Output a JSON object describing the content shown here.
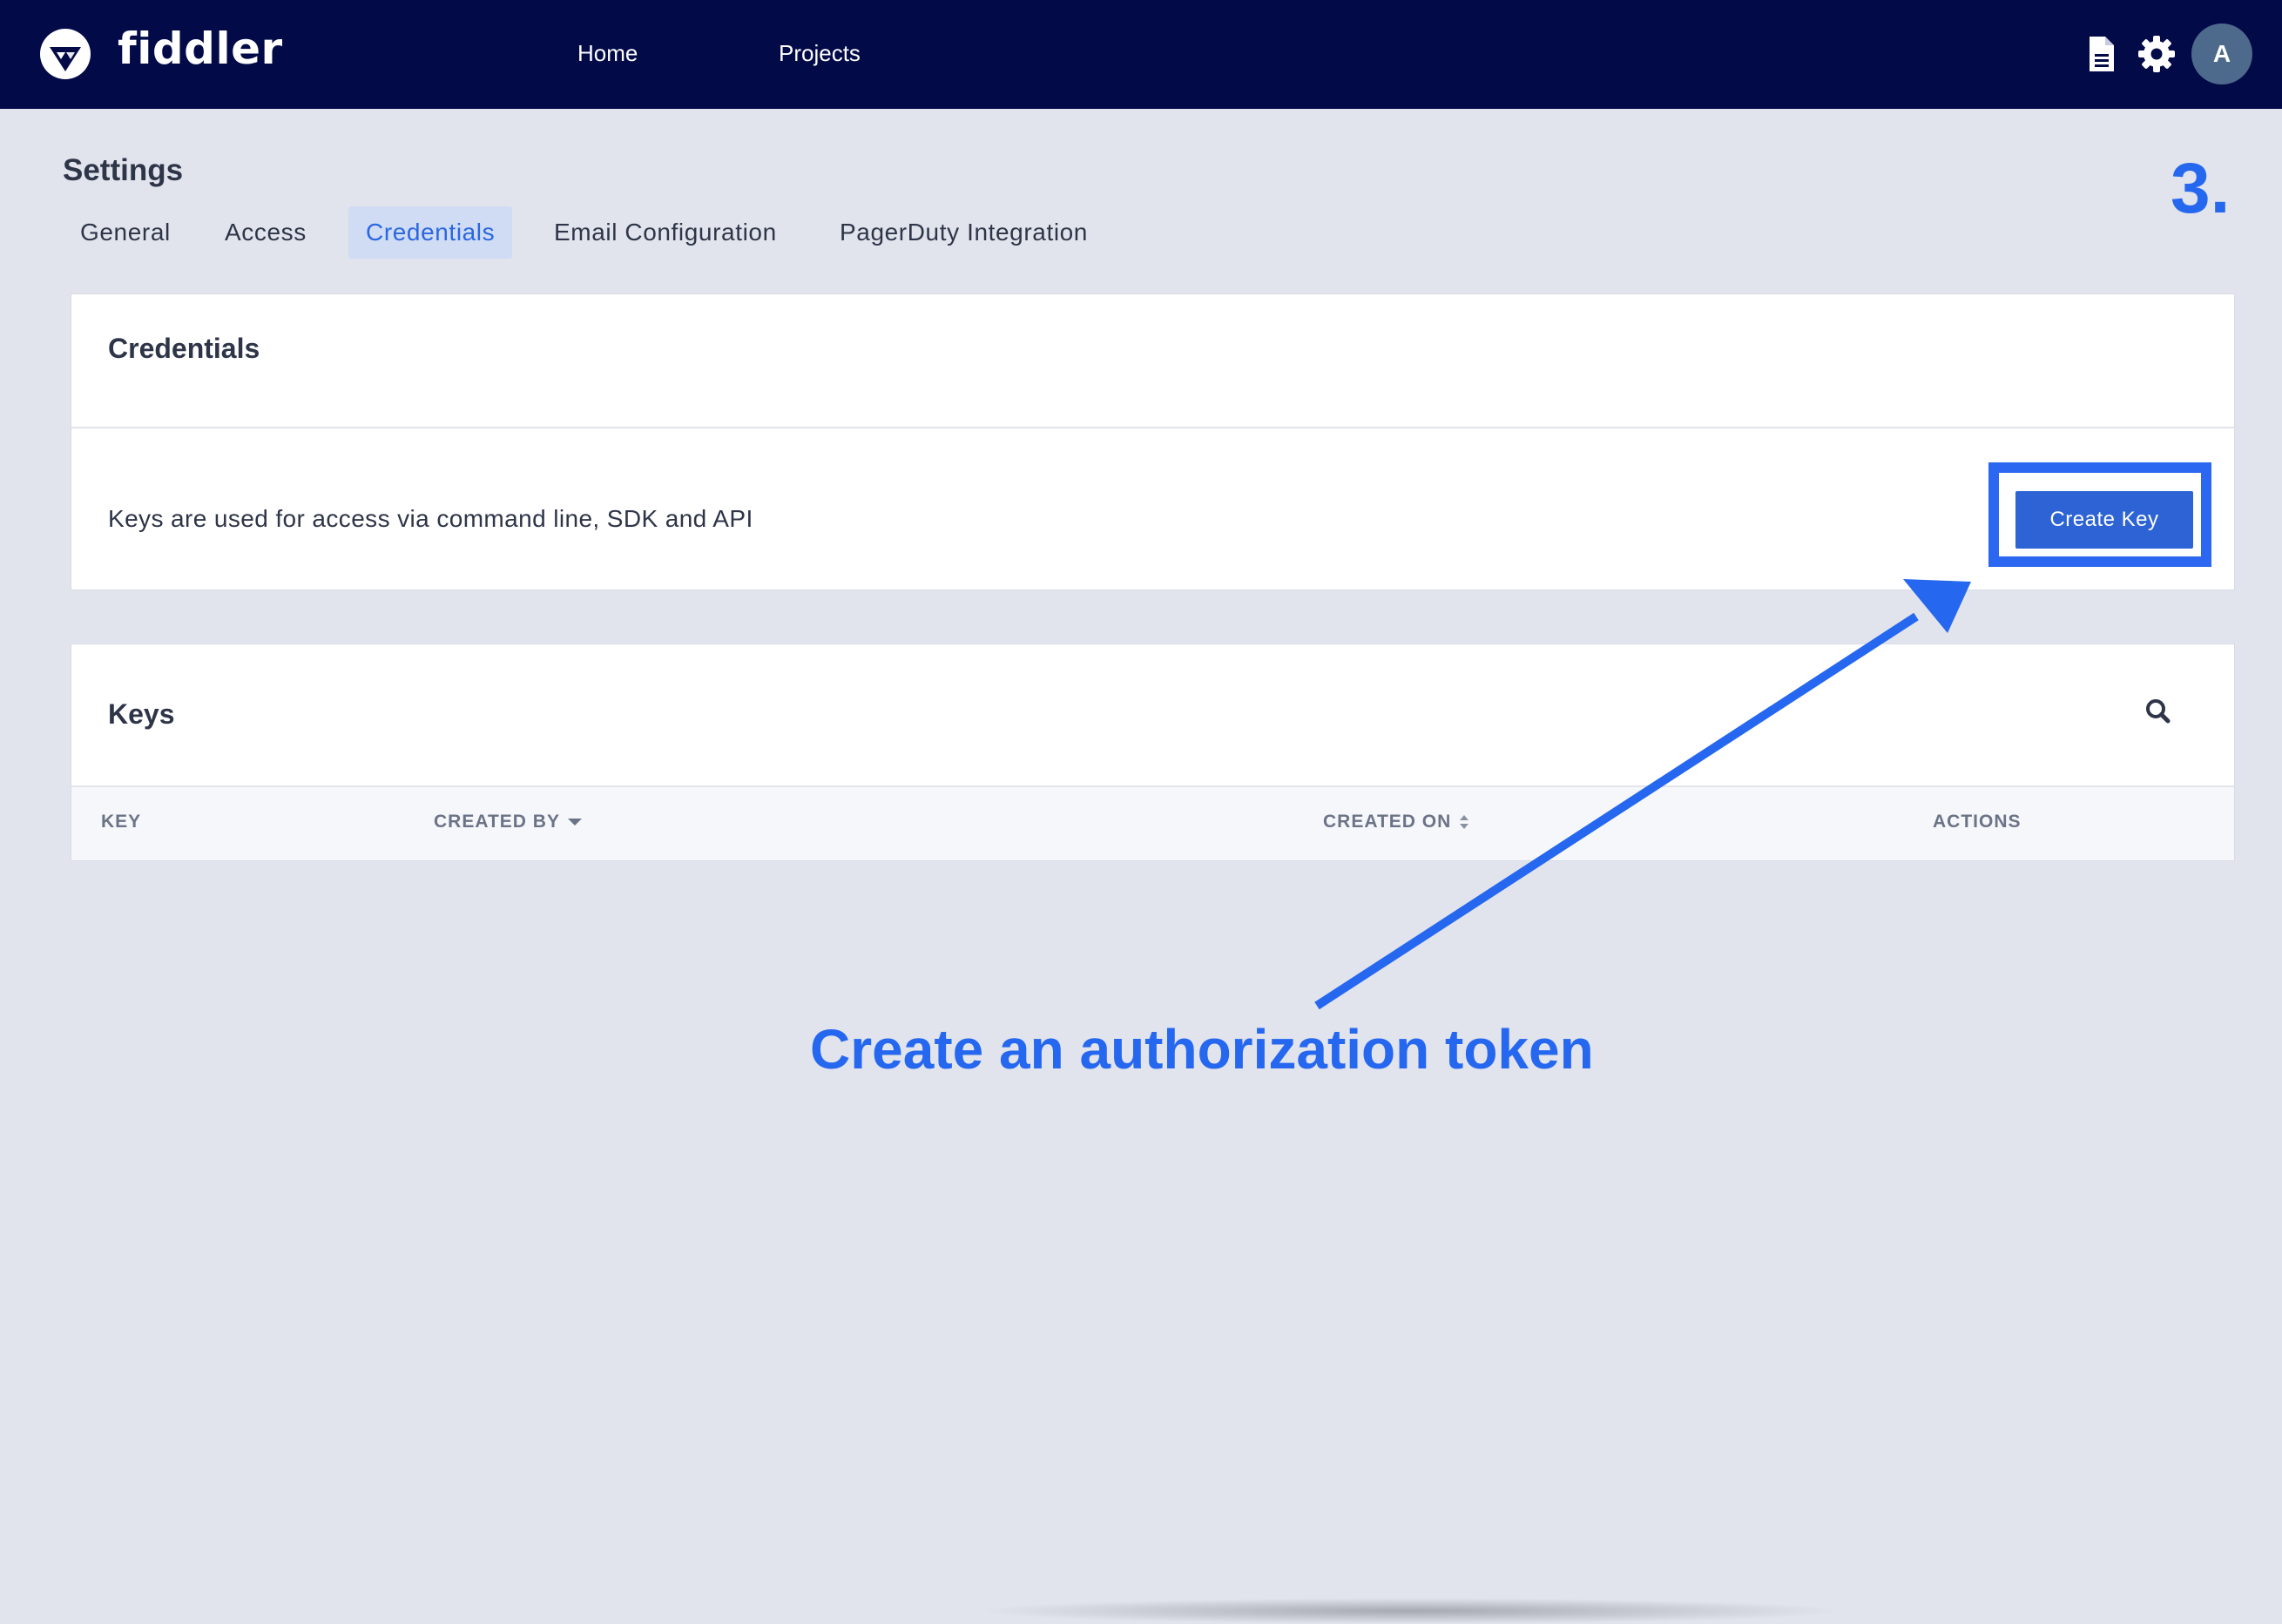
{
  "app": {
    "logo_text": "fiddler",
    "logo_icon": "fiddler-logo-icon"
  },
  "nav": {
    "home": "Home",
    "projects": "Projects",
    "docs_icon": "document-icon",
    "settings_icon": "gear-icon",
    "avatar_initial": "A"
  },
  "page": {
    "title": "Settings",
    "step_number": "3."
  },
  "tabs": [
    {
      "label": "General",
      "active": false
    },
    {
      "label": "Access",
      "active": false
    },
    {
      "label": "Credentials",
      "active": true
    },
    {
      "label": "Email Configuration",
      "active": false
    },
    {
      "label": "PagerDuty Integration",
      "active": false
    }
  ],
  "credentials_card": {
    "heading": "Credentials",
    "description": "Keys are used for access via command line, SDK and API",
    "create_key_label": "Create Key"
  },
  "keys_card": {
    "heading": "Keys",
    "search_icon": "search-icon",
    "columns": [
      {
        "label": "KEY",
        "sort": "none"
      },
      {
        "label": "CREATED BY",
        "sort": "desc"
      },
      {
        "label": "CREATED ON",
        "sort": "both"
      },
      {
        "label": "ACTIONS",
        "sort": "none"
      }
    ]
  },
  "annotation": {
    "text": "Create an authorization token"
  },
  "colors": {
    "nav_bg": "#020a48",
    "page_bg": "#e1e4ec",
    "accent": "#2667f0",
    "button": "#2d63d4",
    "active_tab_bg": "#cfdcf4"
  }
}
